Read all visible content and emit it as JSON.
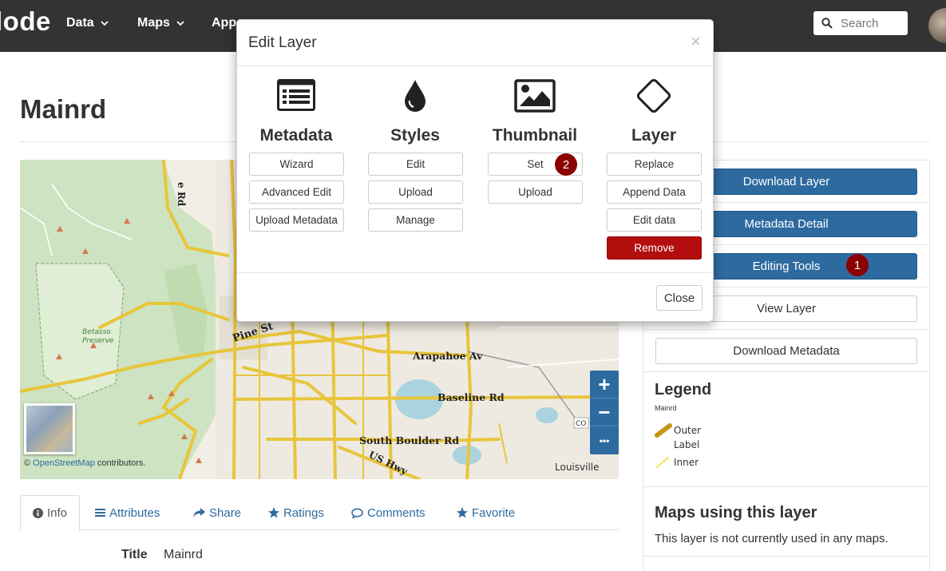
{
  "navbar": {
    "brand": "lode",
    "items": [
      {
        "label": "Data"
      },
      {
        "label": "Maps"
      },
      {
        "label": "Apps"
      }
    ],
    "search_placeholder": "Search"
  },
  "page": {
    "title": "Mainrd"
  },
  "map": {
    "labels": [
      "Pine St",
      "Arapahoe Av",
      "Baseline Rd",
      "South Boulder Rd",
      "US Hwy",
      "Louisville",
      "Betasso Preserve",
      "e Rd",
      "CO"
    ],
    "attribution_prefix": "©",
    "attribution_link": "OpenStreetMap",
    "attribution_suffix": " contributors.",
    "zoom_in": "+",
    "zoom_out": "−",
    "more": "•••"
  },
  "tabs": [
    {
      "label": "Info",
      "icon": "info-icon"
    },
    {
      "label": "Attributes",
      "icon": "list-icon"
    },
    {
      "label": "Share",
      "icon": "share-icon"
    },
    {
      "label": "Ratings",
      "icon": "star-icon"
    },
    {
      "label": "Comments",
      "icon": "comment-icon"
    },
    {
      "label": "Favorite",
      "icon": "star-icon"
    }
  ],
  "info": {
    "title_label": "Title",
    "title_value": "Mainrd"
  },
  "sidebar": {
    "buttons": [
      {
        "label": "Download Layer"
      },
      {
        "label": "Metadata Detail"
      },
      {
        "label": "Editing Tools"
      },
      {
        "label": "View Layer"
      },
      {
        "label": "Download Metadata"
      }
    ],
    "badge_1": "1",
    "legend": {
      "title": "Legend",
      "layer": "Mainrd",
      "items": [
        "Outer",
        "Label",
        "Inner"
      ]
    },
    "maps_title": "Maps using this layer",
    "maps_text": "This layer is not currently used in any maps."
  },
  "modal": {
    "title": "Edit Layer",
    "close_x": "×",
    "columns": [
      {
        "title": "Metadata",
        "icon": "list-box-icon",
        "buttons": [
          "Wizard",
          "Advanced Edit",
          "Upload Metadata"
        ]
      },
      {
        "title": "Styles",
        "icon": "droplet-icon",
        "buttons": [
          "Edit",
          "Upload",
          "Manage"
        ]
      },
      {
        "title": "Thumbnail",
        "icon": "image-icon",
        "buttons": [
          "Set",
          "Upload"
        ]
      },
      {
        "title": "Layer",
        "icon": "diamond-icon",
        "buttons": [
          "Replace",
          "Append Data",
          "Edit data",
          "Remove"
        ]
      }
    ],
    "badge_2": "2",
    "close_button": "Close"
  },
  "colors": {
    "navbar": "#333333",
    "primary": "#2d6a9f",
    "danger": "#b20e0e",
    "badge": "#8b0000",
    "road": "#e8c53a"
  }
}
